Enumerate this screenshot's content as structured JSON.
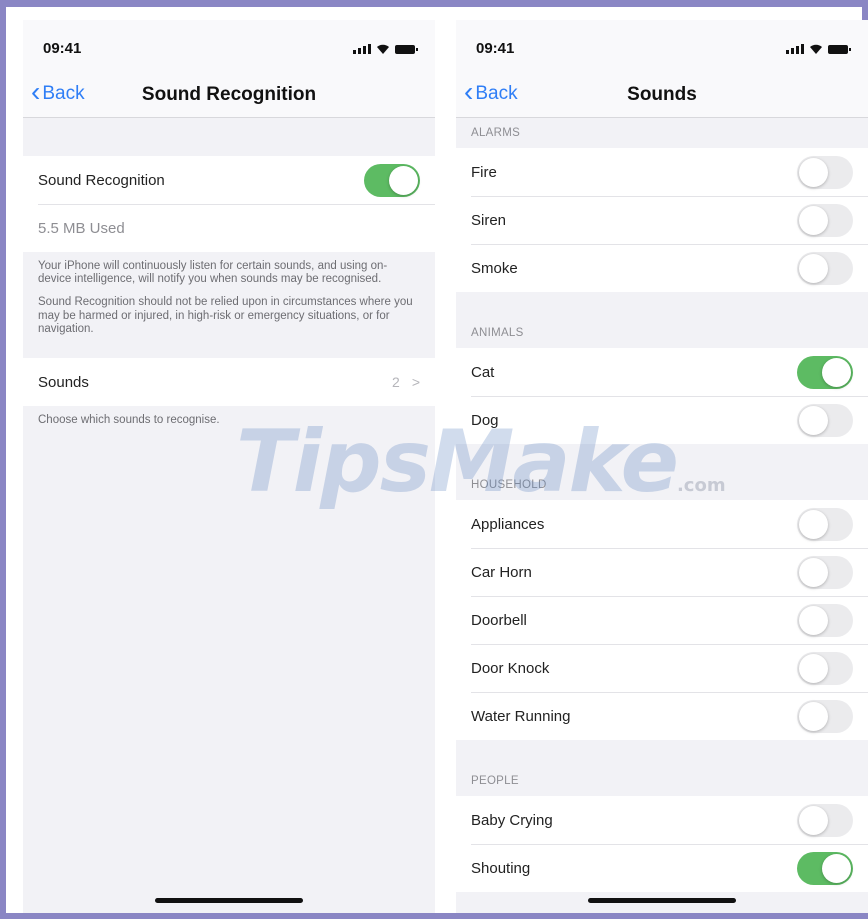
{
  "left": {
    "status": {
      "time": "09:41"
    },
    "nav": {
      "back": "Back",
      "title": "Sound Recognition"
    },
    "toggle_row": {
      "label": "Sound Recognition",
      "state": "on"
    },
    "storage": "5.5 MB Used",
    "description": [
      "Your iPhone will continuously listen for certain sounds, and using on-device intelligence, will notify you when sounds may be recognised.",
      "Sound Recognition should not be relied upon in circumstances where you may be harmed or injured, in high-risk or emergency situations, or for navigation."
    ],
    "sounds_row": {
      "label": "Sounds",
      "count": "2",
      "chevron": ">"
    },
    "sounds_footer": "Choose which sounds to recognise."
  },
  "right": {
    "status": {
      "time": "09:41"
    },
    "nav": {
      "back": "Back",
      "title": "Sounds"
    },
    "sections": [
      {
        "header": "ALARMS",
        "items": [
          {
            "label": "Fire",
            "on": false
          },
          {
            "label": "Siren",
            "on": false
          },
          {
            "label": "Smoke",
            "on": false
          }
        ]
      },
      {
        "header": "ANIMALS",
        "items": [
          {
            "label": "Cat",
            "on": true
          },
          {
            "label": "Dog",
            "on": false
          }
        ]
      },
      {
        "header": "HOUSEHOLD",
        "items": [
          {
            "label": "Appliances",
            "on": false
          },
          {
            "label": "Car Horn",
            "on": false
          },
          {
            "label": "Doorbell",
            "on": false
          },
          {
            "label": "Door Knock",
            "on": false
          },
          {
            "label": "Water Running",
            "on": false
          }
        ]
      },
      {
        "header": "PEOPLE",
        "items": [
          {
            "label": "Baby Crying",
            "on": false
          },
          {
            "label": "Shouting",
            "on": true
          }
        ]
      }
    ]
  },
  "watermark": {
    "brand": "TipsMake",
    "suffix": ".com"
  },
  "colors": {
    "accent": "#2f7ef6",
    "toggle_on": "#5dbb63",
    "border": "#8a86c4"
  },
  "icons": [
    "signal-icon",
    "wifi-icon",
    "battery-icon",
    "location-arrow-icon",
    "back-chevron-icon",
    "chevron-right-icon"
  ]
}
